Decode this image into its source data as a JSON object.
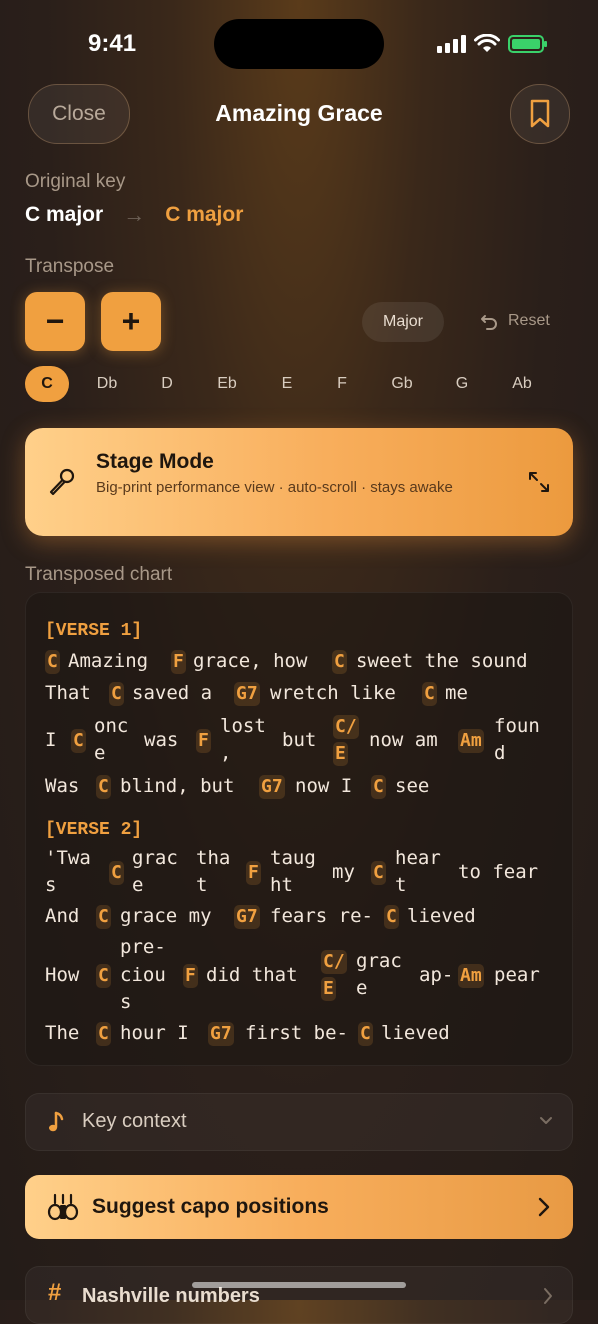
{
  "status": {
    "time": "9:41"
  },
  "nav": {
    "close": "Close",
    "title": "Amazing Grace"
  },
  "original_key": {
    "label": "Original key",
    "from": "C major",
    "arrow": "→",
    "to": "C major"
  },
  "transpose": {
    "label": "Transpose",
    "minus": "−",
    "plus": "+",
    "mode": "Major",
    "reset": "Reset"
  },
  "keys": [
    "C",
    "Db",
    "D",
    "Eb",
    "E",
    "F",
    "Gb",
    "G",
    "Ab"
  ],
  "stage": {
    "title": "Stage Mode",
    "subtitle": "Big-print performance view · auto-scroll · stays awake"
  },
  "chart": {
    "label": "Transposed chart",
    "verse1": "[VERSE 1]",
    "verse2": "[VERSE 2]",
    "l1": [
      "C",
      "Amazing",
      "F",
      "grace, how",
      "C",
      "sweet the sound"
    ],
    "l2": [
      "That",
      "C",
      "saved a",
      "G7",
      "wretch like",
      "C",
      "me"
    ],
    "l3": [
      "I",
      "C",
      "onc",
      "e",
      "was",
      "F",
      "lost",
      ",",
      "but",
      "C/",
      "E",
      "now am",
      "Am",
      "foun",
      "d"
    ],
    "l4": [
      "Was",
      "C",
      "blind, but",
      "G7",
      "now I",
      "C",
      "see"
    ],
    "l5": [
      "'Twa",
      "s",
      "C",
      "grac",
      "e",
      "tha",
      "t",
      "F",
      "taug",
      "ht",
      "my",
      "C",
      "hear",
      "t",
      "to fear"
    ],
    "l6": [
      "And",
      "C",
      "grace my",
      "G7",
      "fears re-",
      "C",
      "lieved"
    ],
    "l7": [
      "How",
      "pre-",
      "C",
      "ciou",
      "s",
      "F",
      "did that",
      "C/",
      "E",
      "grac",
      "e",
      "ap-",
      "Am",
      "pear"
    ],
    "l8": [
      "The",
      "C",
      "hour I",
      "G7",
      "first be-",
      "C",
      "lieved"
    ]
  },
  "key_context": "Key context",
  "capo": "Suggest capo positions",
  "nashville": "Nashville numbers"
}
